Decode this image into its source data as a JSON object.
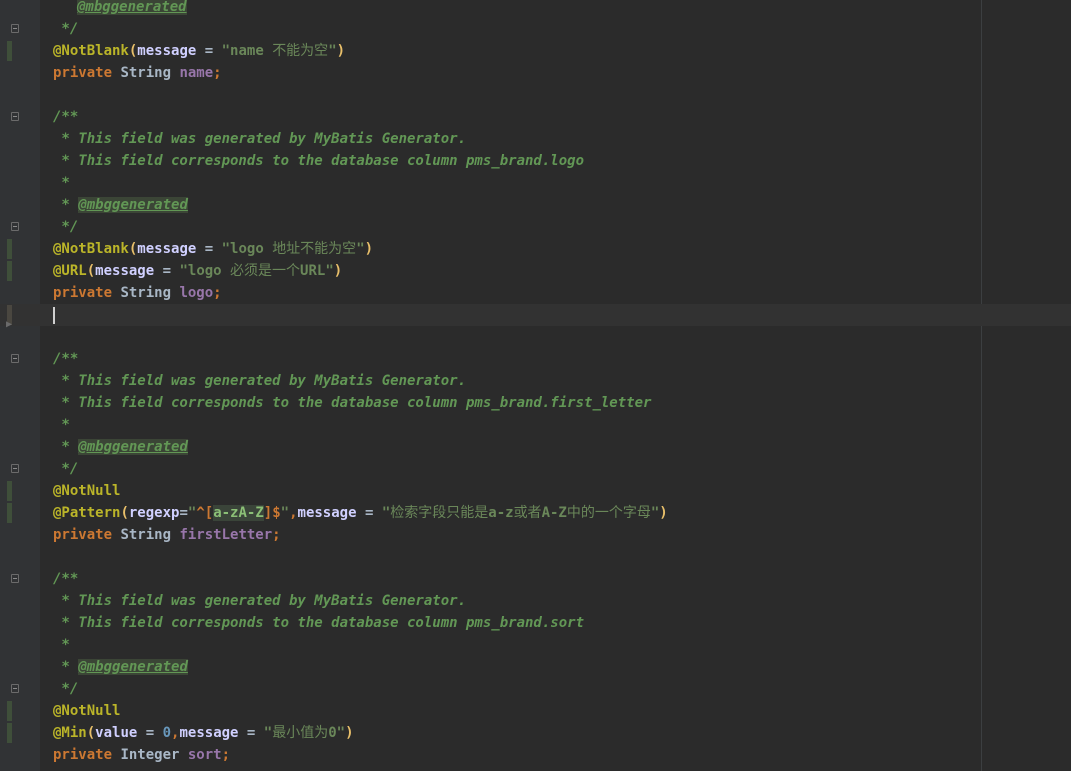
{
  "editor": {
    "lines": [
      {
        "kind": "comment_tag_partial",
        "text": "@mbggenerated"
      },
      {
        "kind": "comment_end",
        "text": " */"
      },
      {
        "kind": "notblank",
        "annotation": "@NotBlank",
        "attr": "message",
        "value_ascii": "\"name ",
        "value_cn": "不能为空",
        "value_tail": "\""
      },
      {
        "kind": "field",
        "modifier": "private",
        "type": "String",
        "name": "name"
      },
      {
        "kind": "blank"
      },
      {
        "kind": "comment_start",
        "text": "/**"
      },
      {
        "kind": "comment",
        "text": " * This field was generated by MyBatis Generator."
      },
      {
        "kind": "comment",
        "text": " * This field corresponds to the database column pms_brand.logo"
      },
      {
        "kind": "comment",
        "text": " *"
      },
      {
        "kind": "comment_tag",
        "prefix": " * ",
        "tag": "@mbggenerated"
      },
      {
        "kind": "comment_end",
        "text": " */"
      },
      {
        "kind": "notblank",
        "annotation": "@NotBlank",
        "attr": "message",
        "value_ascii": "\"logo ",
        "value_cn": "地址不能为空",
        "value_tail": "\""
      },
      {
        "kind": "url",
        "annotation": "@URL",
        "attr": "message",
        "value_ascii": "\"logo ",
        "value_cn": "必须是一个",
        "value_tail": "URL\""
      },
      {
        "kind": "field",
        "modifier": "private",
        "type": "String",
        "name": "logo"
      },
      {
        "kind": "caret"
      },
      {
        "kind": "blank"
      },
      {
        "kind": "comment_start",
        "text": "/**"
      },
      {
        "kind": "comment",
        "text": " * This field was generated by MyBatis Generator."
      },
      {
        "kind": "comment",
        "text": " * This field corresponds to the database column pms_brand.first_letter"
      },
      {
        "kind": "comment",
        "text": " *"
      },
      {
        "kind": "comment_tag",
        "prefix": " * ",
        "tag": "@mbggenerated"
      },
      {
        "kind": "comment_end",
        "text": " */"
      },
      {
        "kind": "annotation_only",
        "annotation": "@NotNull"
      },
      {
        "kind": "pattern",
        "annotation": "@Pattern",
        "attr1": "regexp",
        "rx_open": "^[",
        "rx_body": "a-zA-Z",
        "rx_close": "]",
        "rx_end": "$",
        "attr2": "message",
        "value_open": "\"",
        "value_cn1": "检索字段只能是",
        "value_a": "a-z",
        "value_cn2": "或者",
        "value_b": "A-Z",
        "value_cn3": "中的一个字母",
        "value_close": "\""
      },
      {
        "kind": "field",
        "modifier": "private",
        "type": "String",
        "name": "firstLetter"
      },
      {
        "kind": "blank"
      },
      {
        "kind": "comment_start",
        "text": "/**"
      },
      {
        "kind": "comment",
        "text": " * This field was generated by MyBatis Generator."
      },
      {
        "kind": "comment",
        "text": " * This field corresponds to the database column pms_brand.sort"
      },
      {
        "kind": "comment",
        "text": " *"
      },
      {
        "kind": "comment_tag",
        "prefix": " * ",
        "tag": "@mbggenerated"
      },
      {
        "kind": "comment_end",
        "text": " */"
      },
      {
        "kind": "annotation_only",
        "annotation": "@NotNull"
      },
      {
        "kind": "min",
        "annotation": "@Min",
        "attr1": "value",
        "num": "0",
        "attr2": "message",
        "value_open": "\"",
        "value_cn": "最小值为",
        "value_tail": "0\""
      },
      {
        "kind": "field",
        "modifier": "private",
        "type": "Integer",
        "name": "sort"
      }
    ]
  },
  "colors": {
    "background": "#2b2b2b",
    "gutter": "#313335",
    "keyword": "#cc7832",
    "annotation": "#bbb529",
    "string": "#6a8759",
    "comment": "#629755",
    "field": "#9876aa",
    "number": "#6897bb"
  },
  "icons": {
    "fold_marker": "fold-icon",
    "breakpoint_arrow": "collapsed-arrow-icon"
  }
}
